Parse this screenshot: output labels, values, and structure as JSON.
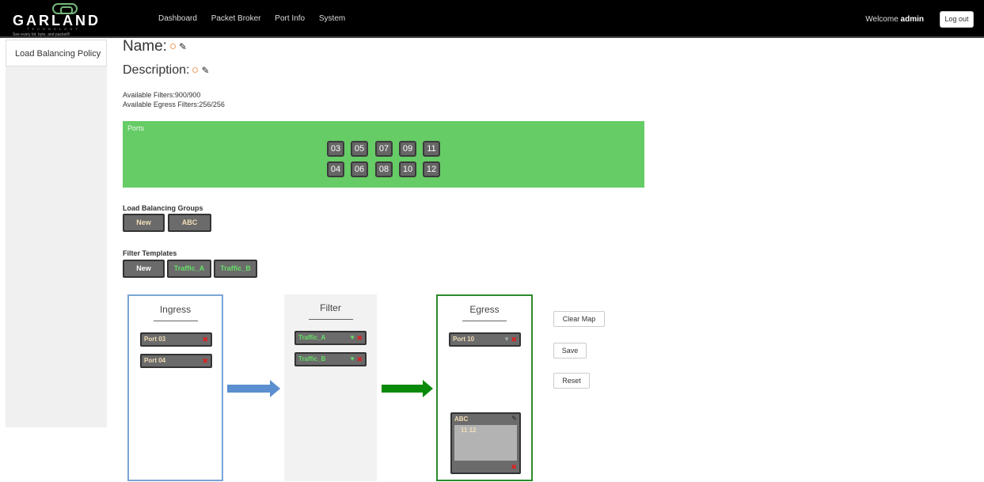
{
  "logo": {
    "brand": "GARLAND",
    "sub": "TECHNOLOGY",
    "tagline": "See every bit, byte, and packet®"
  },
  "nav": {
    "items": [
      "Dashboard",
      "Packet Broker",
      "Port Info",
      "System"
    ]
  },
  "user": {
    "welcome": "Welcome",
    "name": "admin",
    "logout_label": "Log out"
  },
  "sidebar": {
    "items": [
      "Load Balancing Policy"
    ]
  },
  "policy": {
    "name_label": "Name:",
    "description_label": "Description:"
  },
  "availability": {
    "filters": "Available Filters:900/900",
    "egress_filters": "Available Egress Filters:256/256"
  },
  "ports": {
    "label": "Ports",
    "top_row": [
      "03",
      "05",
      "07",
      "09",
      "11"
    ],
    "bottom_row": [
      "04",
      "06",
      "08",
      "10",
      "12"
    ]
  },
  "lb_groups": {
    "label": "Load Balancing Groups",
    "new_label": "New",
    "items": [
      "ABC"
    ]
  },
  "filter_templates": {
    "label": "Filter Templates",
    "new_label": "New",
    "items": [
      "Traffic_A",
      "Traffic_B"
    ]
  },
  "map": {
    "ingress": {
      "title": "Ingress",
      "items": [
        "Port 03",
        "Port 04"
      ]
    },
    "filter": {
      "title": "Filter",
      "items": [
        "Traffic_A",
        "Traffic_B"
      ]
    },
    "egress": {
      "title": "Egress",
      "items": [
        "Port 10"
      ],
      "group": {
        "name": "ABC",
        "ports": "11  12"
      }
    }
  },
  "actions": {
    "clear_map": "Clear Map",
    "save": "Save",
    "reset": "Reset"
  },
  "colors": {
    "ports_panel": "#66cc66",
    "ingress_border": "#7aa6d6",
    "egress_border": "#2b8a2b",
    "filter_arrow": "#5b8fd0",
    "egress_arrow": "#0a8a0a"
  }
}
